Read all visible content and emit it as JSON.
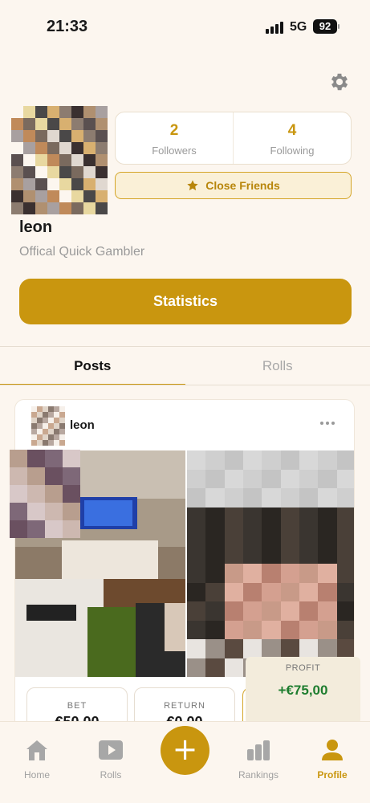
{
  "status_bar": {
    "time": "21:33",
    "network": "5G",
    "battery": "92"
  },
  "profile": {
    "followers_count": "2",
    "followers_label": "Followers",
    "following_count": "4",
    "following_label": "Following",
    "close_friends_label": "Close Friends",
    "username": "leon",
    "bio": "Offical Quick Gambler",
    "statistics_label": "Statistics"
  },
  "tabs": [
    {
      "label": "Posts",
      "active": true
    },
    {
      "label": "Rolls",
      "active": false
    }
  ],
  "post": {
    "username": "leon",
    "bet_label": "BET",
    "bet_value": "€50,00",
    "return_label": "RETURN",
    "return_value": "€0,00",
    "profit_label": "PROFIT",
    "profit_value": "+€75,00"
  },
  "nav": [
    {
      "label": "Home",
      "icon": "home-icon",
      "active": false
    },
    {
      "label": "Rolls",
      "icon": "play-icon",
      "active": false
    },
    {
      "label": "Rankings",
      "icon": "bar-chart-icon",
      "active": false
    },
    {
      "label": "Profile",
      "icon": "person-icon",
      "active": true
    }
  ],
  "colors": {
    "accent": "#c9960f",
    "background": "#fcf6ef",
    "profit_green": "#1e7d2f"
  }
}
